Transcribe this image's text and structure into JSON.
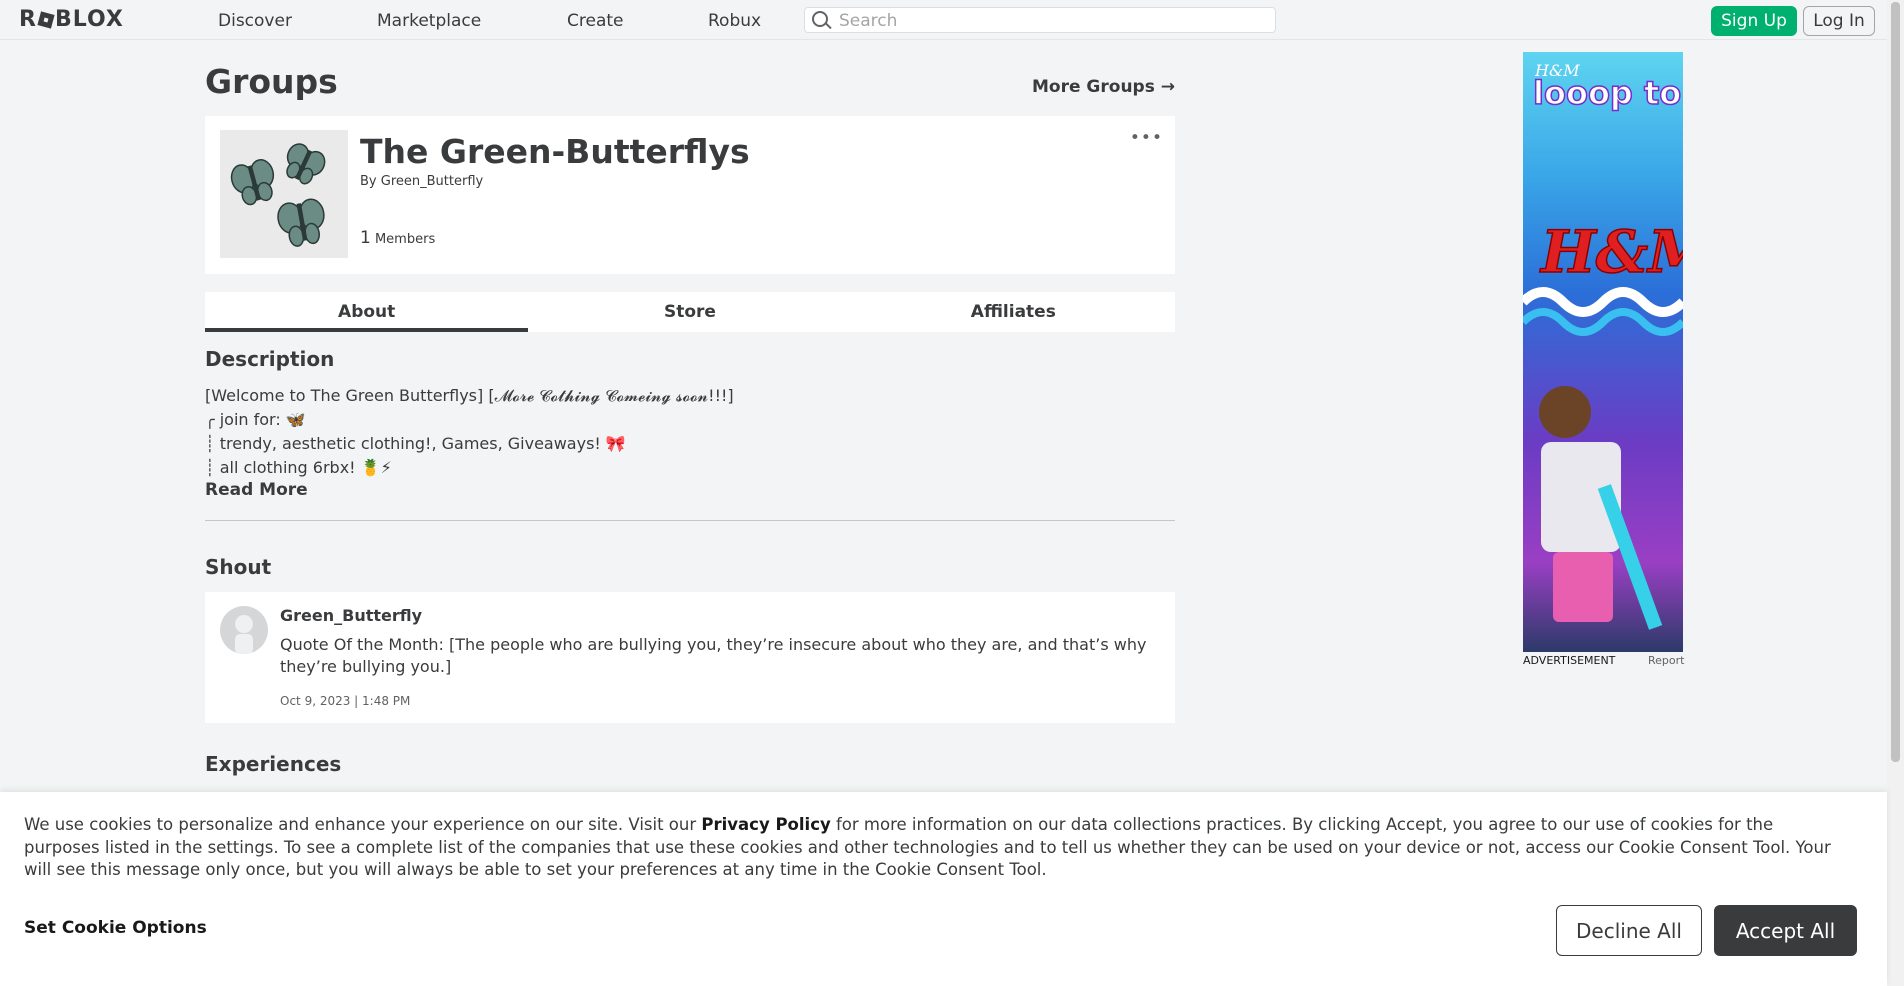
{
  "nav": {
    "logo": "ROBLOX",
    "items": [
      "Discover",
      "Marketplace",
      "Create",
      "Robux"
    ],
    "search_placeholder": "Search",
    "signup": "Sign Up",
    "login": "Log In"
  },
  "page": {
    "title": "Groups",
    "more_groups": "More Groups →"
  },
  "group": {
    "name": "The Green-Butterflys",
    "by_prefix": "By",
    "owner": "Green_Butterfly",
    "member_count": "1",
    "members_label": "Members",
    "more_dots": "•••"
  },
  "tabs": [
    "About",
    "Store",
    "Affiliates"
  ],
  "description": {
    "title": "Description",
    "lines": [
      "[Welcome to The Green Butterflys] [𝓜𝓸𝓻𝓮 𝓒𝓸𝓽𝓱𝓲𝓷𝓰 𝓒𝓸𝓶𝓮𝓲𝓷𝓰 𝓼𝓸𝓸𝓷!!!]",
      "╭ join for: 🦋",
      "┊ trendy, aesthetic clothing!, Games, Giveaways! 🎀",
      "┊ all clothing 6rbx! 🍍⚡"
    ],
    "read_more": "Read More"
  },
  "shout": {
    "title": "Shout",
    "poster": "Green_Butterfly",
    "body": "Quote Of the Month: [The people who are bullying you, they’re insecure about who they are, and that’s why they’re bullying you.]",
    "date": "Oct 9, 2023 | 1:48 PM"
  },
  "experiences": {
    "title": "Experiences"
  },
  "ad": {
    "label": "ADVERTISEMENT",
    "report": "Report",
    "brand_text": "H&M",
    "headline": "looop topia"
  },
  "cookie": {
    "text_before": "We use cookies to personalize and enhance your experience on our site. Visit our ",
    "link": "Privacy Policy",
    "text_after": " for more information on our data collections practices. By clicking Accept, you agree to our use of cookies for the purposes listed in the settings. To see a complete list of the companies that use these cookies and other technologies and to tell us whether they can be used on your device or not, access our Cookie Consent Tool. Your will see this message only once, but you will always be able to set your preferences at any time in the Cookie Consent Tool.",
    "set_options": "Set Cookie Options",
    "decline": "Decline All",
    "accept": "Accept All"
  }
}
